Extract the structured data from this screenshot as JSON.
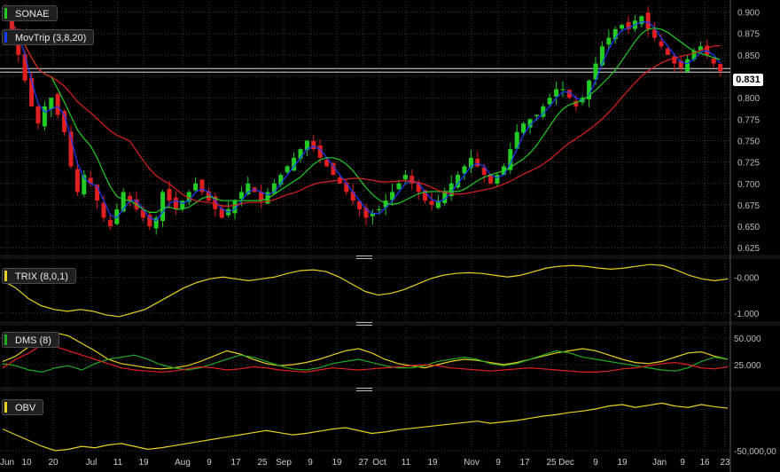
{
  "instrument": "SONAE",
  "last_price": "0.831",
  "indicator_labels": {
    "mov": "MovTrip (3,8,20)",
    "trix": "TRIX (8,0,1)",
    "dms": "DMS (8)",
    "obv": "OBV"
  },
  "colors": {
    "background": "#000000",
    "grid": "#3a3a3a",
    "up_candle": "#22cc22",
    "down_candle": "#e02020",
    "ma_fast": "#1a3cff",
    "ma_mid": "#22cc22",
    "ma_slow": "#e02020",
    "trix": "#e8d020",
    "dms_plus": "#22aa22",
    "dms_minus": "#e02020",
    "dms_adx": "#e8d020",
    "obv": "#e8d020"
  },
  "chart_data": [
    {
      "type": "candlestick",
      "panel": "price",
      "y_ticks": [
        "0.900",
        "0.875",
        "0.850",
        "0.825",
        "0.800",
        "0.775",
        "0.750",
        "0.725",
        "0.700",
        "0.675",
        "0.650",
        "0.625"
      ],
      "ylim": [
        0.618,
        0.912
      ],
      "x_ticks": [
        "Jun",
        "10",
        "20",
        "Jul",
        "11",
        "19",
        "Aug",
        "9",
        "17",
        "25",
        "Sep",
        "9",
        "19",
        "27",
        "Oct",
        "11",
        "19",
        "Nov",
        "9",
        "17",
        "25",
        "Dec",
        "9",
        "19",
        "Jan",
        "9",
        "16",
        "23"
      ],
      "close_series": [
        0.895,
        0.88,
        0.85,
        0.82,
        0.79,
        0.77,
        0.79,
        0.8,
        0.78,
        0.76,
        0.72,
        0.69,
        0.71,
        0.7,
        0.68,
        0.66,
        0.65,
        0.67,
        0.69,
        0.68,
        0.67,
        0.66,
        0.65,
        0.66,
        0.69,
        0.68,
        0.67,
        0.68,
        0.69,
        0.7,
        0.69,
        0.68,
        0.67,
        0.66,
        0.67,
        0.68,
        0.69,
        0.7,
        0.69,
        0.68,
        0.69,
        0.7,
        0.71,
        0.72,
        0.73,
        0.74,
        0.75,
        0.74,
        0.73,
        0.72,
        0.71,
        0.7,
        0.69,
        0.68,
        0.67,
        0.66,
        0.665,
        0.67,
        0.68,
        0.69,
        0.7,
        0.71,
        0.7,
        0.69,
        0.68,
        0.675,
        0.68,
        0.69,
        0.7,
        0.71,
        0.72,
        0.73,
        0.72,
        0.71,
        0.7,
        0.71,
        0.72,
        0.74,
        0.76,
        0.77,
        0.775,
        0.78,
        0.79,
        0.8,
        0.81,
        0.81,
        0.8,
        0.79,
        0.8,
        0.82,
        0.84,
        0.86,
        0.87,
        0.88,
        0.885,
        0.88,
        0.89,
        0.895,
        0.88,
        0.87,
        0.86,
        0.85,
        0.84,
        0.835,
        0.845,
        0.855,
        0.86,
        0.85,
        0.84,
        0.831
      ],
      "moving_averages": [
        "MovTrip (3,8,20)"
      ],
      "last_value": 0.831
    },
    {
      "type": "line",
      "panel": "trix",
      "y_ticks": [
        "-0.000",
        "-1.000"
      ],
      "ylim": [
        -1.2,
        0.45
      ],
      "series": [
        {
          "name": "TRIX (8,0,1)",
          "values": [
            -0.1,
            -0.3,
            -0.6,
            -0.8,
            -0.9,
            -0.95,
            -0.9,
            -0.95,
            -1.05,
            -1.1,
            -1.0,
            -0.9,
            -0.7,
            -0.5,
            -0.3,
            -0.15,
            -0.05,
            0.0,
            -0.05,
            -0.1,
            -0.05,
            0.0,
            0.1,
            0.18,
            0.2,
            0.15,
            0.0,
            -0.2,
            -0.4,
            -0.5,
            -0.45,
            -0.35,
            -0.2,
            -0.05,
            0.05,
            0.1,
            0.12,
            0.1,
            0.05,
            0.0,
            0.05,
            0.15,
            0.25,
            0.3,
            0.32,
            0.3,
            0.25,
            0.22,
            0.25,
            0.3,
            0.35,
            0.32,
            0.2,
            0.05,
            -0.05,
            -0.1,
            -0.05
          ]
        }
      ]
    },
    {
      "type": "line",
      "panel": "dms",
      "y_ticks": [
        "50.000",
        "25.000"
      ],
      "ylim": [
        5,
        60
      ],
      "series": [
        {
          "name": "DMS (8)",
          "values": [
            28,
            33,
            42,
            50,
            55,
            52,
            45,
            38,
            30,
            26,
            24,
            22,
            21,
            22,
            24,
            28,
            33,
            38,
            35,
            30,
            26,
            24,
            25,
            27,
            30,
            34,
            38,
            40,
            36,
            30,
            26,
            24,
            22,
            25,
            28,
            30,
            29,
            27,
            25,
            27,
            30,
            33,
            36,
            38,
            40,
            38,
            34,
            30,
            27,
            26,
            28,
            32,
            36,
            37,
            33,
            30
          ]
        },
        {
          "name": "",
          "values": [
            26,
            24,
            20,
            18,
            22,
            24,
            20,
            26,
            30,
            32,
            34,
            30,
            25,
            22,
            20,
            22,
            26,
            30,
            34,
            32,
            28,
            24,
            21,
            20,
            22,
            26,
            28,
            30,
            27,
            24,
            22,
            22,
            24,
            28,
            30,
            32,
            30,
            26,
            24,
            26,
            30,
            34,
            38,
            36,
            32,
            30,
            28,
            26,
            24,
            22,
            20,
            19,
            22,
            28,
            32,
            30
          ]
        },
        {
          "name": "",
          "values": [
            22,
            30,
            36,
            44,
            42,
            38,
            34,
            30,
            26,
            22,
            20,
            19,
            18,
            19,
            21,
            23,
            22,
            20,
            21,
            23,
            22,
            20,
            19,
            18,
            20,
            22,
            21,
            20,
            21,
            22,
            23,
            24,
            25,
            24,
            22,
            21,
            20,
            19,
            20,
            21,
            22,
            21,
            20,
            19,
            18,
            18,
            19,
            21,
            22,
            24,
            26,
            27,
            25,
            22,
            21,
            23
          ]
        }
      ]
    },
    {
      "type": "line",
      "panel": "obv",
      "y_ticks": [
        "-50,000,00"
      ],
      "ylim": [
        -50,
        30
      ],
      "series": [
        {
          "name": "OBV",
          "values": [
            -20,
            -28,
            -36,
            -44,
            -50,
            -48,
            -44,
            -46,
            -42,
            -40,
            -44,
            -48,
            -46,
            -43,
            -40,
            -37,
            -34,
            -31,
            -28,
            -25,
            -22,
            -25,
            -28,
            -26,
            -23,
            -20,
            -18,
            -22,
            -26,
            -24,
            -21,
            -19,
            -17,
            -15,
            -13,
            -11,
            -9,
            -12,
            -10,
            -8,
            -5,
            -2,
            0,
            3,
            5,
            8,
            12,
            14,
            10,
            13,
            16,
            12,
            10,
            14,
            11,
            9
          ]
        }
      ]
    }
  ]
}
